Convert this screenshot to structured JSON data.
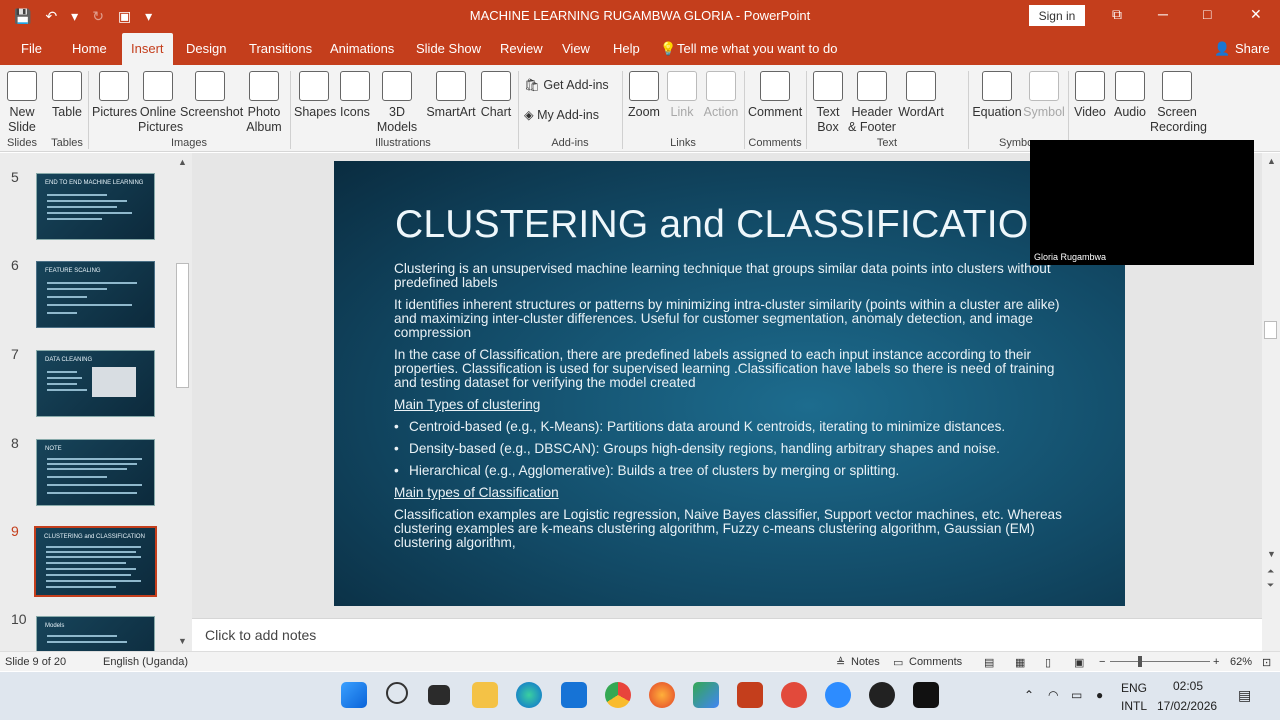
{
  "window": {
    "title": "MACHINE LEARNING RUGAMBWA GLORIA",
    "separator": "-",
    "app": "PowerPoint",
    "signin": "Sign in"
  },
  "qat": {
    "save": "💾",
    "undo": "↶",
    "undo_drop": "▾",
    "redo": "↻",
    "present": "▣",
    "more": "▾"
  },
  "winctl": {
    "restore": "⧉",
    "minimize": "─",
    "maximize": "□",
    "close": "✕"
  },
  "tabs": [
    "File",
    "Home",
    "Insert",
    "Design",
    "Transitions",
    "Animations",
    "Slide Show",
    "Review",
    "View",
    "Help"
  ],
  "tell_me": "Tell me what you want to do",
  "share": "Share",
  "ribbon": {
    "new_slide": "New Slide",
    "table": "Table",
    "pictures": "Pictures",
    "online_pictures": "Online Pictures",
    "screenshot": "Screenshot",
    "photo_album": "Photo Album",
    "shapes": "Shapes",
    "icons": "Icons",
    "3d_models": "3D Models",
    "smartart": "SmartArt",
    "chart": "Chart",
    "get_addins": "Get Add-ins",
    "my_addins": "My Add-ins",
    "zoom": "Zoom",
    "link": "Link",
    "action": "Action",
    "comment": "Comment",
    "text_box": "Text Box",
    "header_footer": "Header & Footer",
    "wordart": "WordArt",
    "equation": "Equation",
    "symbol": "Symbol",
    "video": "Video",
    "audio": "Audio",
    "screen_recording": "Screen Recording",
    "groups": {
      "slides": "Slides",
      "tables": "Tables",
      "images": "Images",
      "illustrations": "Illustrations",
      "addins": "Add-ins",
      "links": "Links",
      "comments": "Comments",
      "text": "Text",
      "symbols": "Symbo"
    }
  },
  "thumbnails": [
    {
      "num": "5",
      "title": "END TO END MACHINE LEARNING"
    },
    {
      "num": "6",
      "title": "FEATURE SCALING"
    },
    {
      "num": "7",
      "title": "DATA CLEANING"
    },
    {
      "num": "8",
      "title": "NOTE"
    },
    {
      "num": "9",
      "title": "CLUSTERING and CLASSIFICATION"
    },
    {
      "num": "10",
      "title": "Models"
    }
  ],
  "slide": {
    "title": "CLUSTERING and CLASSIFICATION",
    "p1": "Clustering is an unsupervised machine learning technique that groups similar data points into clusters without predefined labels",
    "p2": "It identifies inherent structures or patterns by minimizing intra-cluster similarity (points within a cluster are alike) and maximizing inter-cluster differences. Useful for customer segmentation, anomaly detection, and image compression",
    "p3": "In the case of Classification, there are predefined labels assigned to each input instance according to their properties. Classification is used for supervised learning .Classification have labels so there is need of training and testing dataset for verifying the model created",
    "h1": "Main Types of clustering",
    "b1": "Centroid-based (e.g., K-Means): Partitions data around K centroids, iterating to minimize distances.",
    "b2": "Density-based (e.g., DBSCAN): Groups high-density regions, handling arbitrary shapes and noise.",
    "b3": "Hierarchical (e.g., Agglomerative): Builds a tree of clusters by merging or splitting.",
    "h2": "Main types of Classification",
    "p4": "Classification examples are Logistic regression, Naive Bayes classifier, Support vector machines, etc. Whereas clustering examples are k-means clustering algorithm, Fuzzy c-means clustering algorithm, Gaussian (EM) clustering algorithm,"
  },
  "camera_name": "Gloria Rugambwa",
  "notes_placeholder": "Click to add notes",
  "status": {
    "slide": "Slide 9 of 20",
    "language": "English (Uganda)",
    "notes": "Notes",
    "comments": "Comments",
    "zoom": "62%",
    "minus": "−",
    "plus": "+"
  },
  "tray": {
    "lang1": "ENG",
    "lang2": "INTL",
    "time": "02:05",
    "date": "17/02/2026"
  }
}
